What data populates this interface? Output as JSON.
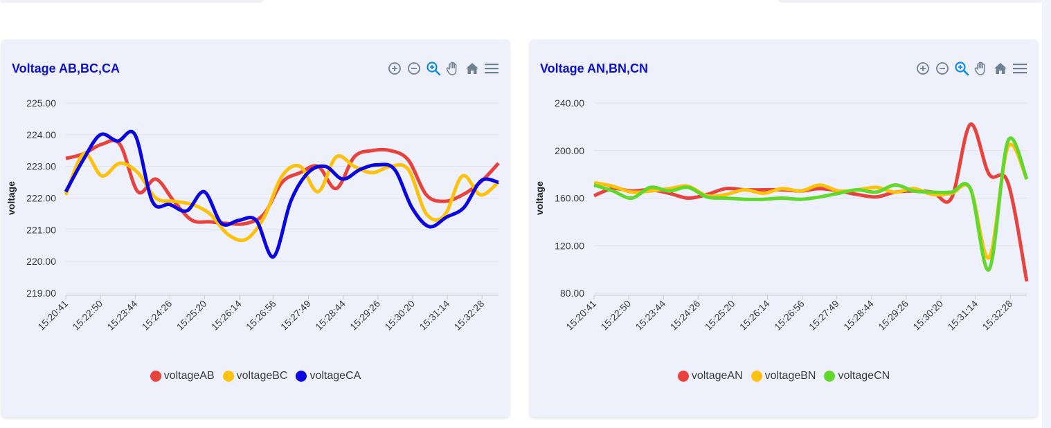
{
  "chart_data": [
    {
      "type": "line",
      "title": "Voltage AB,BC,CA",
      "ylabel": "voltage",
      "xlabel": "",
      "ylim": [
        219,
        225
      ],
      "y_ticks": [
        "219.00",
        "220.00",
        "221.00",
        "222.00",
        "223.00",
        "224.00",
        "225.00"
      ],
      "x_ticks": [
        "15:20:41",
        "15:22:50",
        "15:23:44",
        "15:24:26",
        "15:25:20",
        "15:26:14",
        "15:26:56",
        "15:27:49",
        "15:28:44",
        "15:29:26",
        "15:30:20",
        "15:31:14",
        "15:32:28"
      ],
      "grid": true,
      "legend_position": "bottom-center",
      "series": [
        {
          "name": "voltageAB",
          "color": "#e8423d",
          "values": [
            223.25,
            223.4,
            223.7,
            223.7,
            222.2,
            222.6,
            221.9,
            221.3,
            221.25,
            221.2,
            221.2,
            221.5,
            222.5,
            222.8,
            223.0,
            222.3,
            223.3,
            223.5,
            223.5,
            223.2,
            222.1,
            221.9,
            222.1,
            222.5,
            223.1
          ]
        },
        {
          "name": "voltageBC",
          "color": "#fcc20d",
          "values": [
            222.1,
            223.4,
            222.7,
            223.1,
            222.8,
            222.0,
            221.9,
            221.8,
            221.5,
            220.85,
            220.7,
            221.4,
            222.7,
            223.0,
            222.2,
            223.3,
            223.0,
            222.8,
            223.0,
            222.9,
            221.5,
            221.45,
            222.7,
            222.1,
            222.5
          ]
        },
        {
          "name": "voltageCA",
          "color": "#0a05e0",
          "values": [
            222.2,
            223.2,
            224.0,
            223.8,
            224.0,
            221.9,
            221.8,
            221.6,
            222.2,
            221.2,
            221.3,
            221.3,
            220.15,
            221.9,
            222.8,
            223.0,
            222.6,
            222.9,
            223.05,
            222.9,
            221.7,
            221.1,
            221.4,
            221.7,
            222.55,
            222.5
          ]
        }
      ]
    },
    {
      "type": "line",
      "title": "Voltage AN,BN,CN",
      "ylabel": "voltage",
      "xlabel": "",
      "ylim": [
        80,
        240
      ],
      "y_ticks": [
        "80.00",
        "120.00",
        "160.00",
        "200.00",
        "240.00"
      ],
      "x_ticks": [
        "15:20:41",
        "15:22:50",
        "15:23:44",
        "15:24:26",
        "15:25:20",
        "15:26:14",
        "15:26:56",
        "15:27:49",
        "15:28:44",
        "15:29:26",
        "15:30:20",
        "15:31:14",
        "15:32:28"
      ],
      "grid": true,
      "legend_position": "bottom-center",
      "series": [
        {
          "name": "voltageAN",
          "color": "#e8423d",
          "values": [
            162,
            168,
            166,
            167,
            164,
            160,
            163,
            168,
            167,
            167,
            167,
            166,
            168,
            166,
            163,
            161,
            165,
            166,
            165,
            160,
            222,
            180,
            173,
            90
          ]
        },
        {
          "name": "voltageBN",
          "color": "#fcc20d",
          "values": [
            173,
            170,
            165,
            166,
            168,
            170,
            162,
            163,
            167,
            164,
            168,
            166,
            171,
            166,
            167,
            169,
            165,
            168,
            163,
            164,
            168,
            110,
            203,
            176
          ]
        },
        {
          "name": "voltageCN",
          "color": "#62d82f",
          "values": [
            171,
            166,
            160,
            169,
            166,
            169,
            161,
            160,
            159,
            159,
            160,
            159,
            161,
            164,
            167,
            165,
            171,
            166,
            165,
            165,
            168,
            100,
            208,
            176
          ]
        }
      ]
    }
  ]
}
